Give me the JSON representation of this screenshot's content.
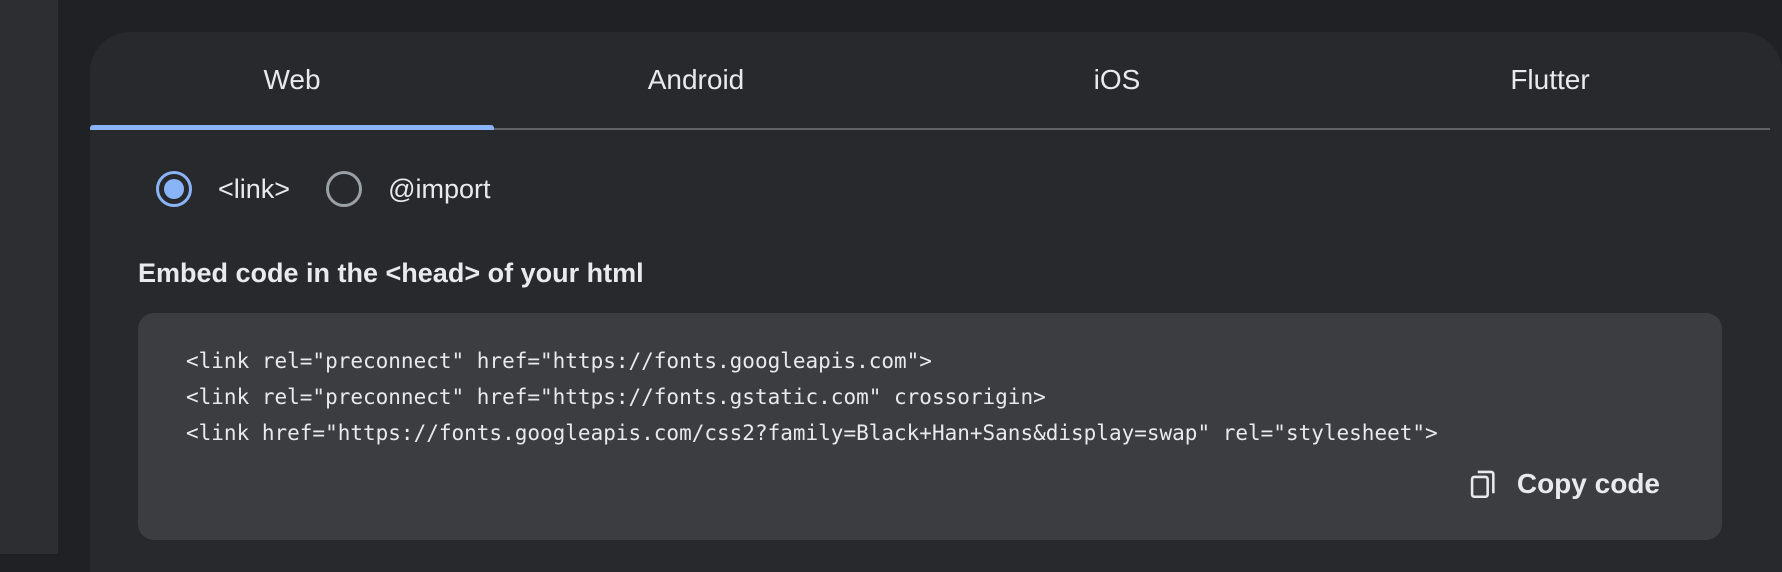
{
  "tabs": [
    {
      "label": "Web",
      "selected": true
    },
    {
      "label": "Android",
      "selected": false
    },
    {
      "label": "iOS",
      "selected": false
    },
    {
      "label": "Flutter",
      "selected": false
    }
  ],
  "embed_options": [
    {
      "label": "<link>",
      "checked": true
    },
    {
      "label": "@import",
      "checked": false
    }
  ],
  "embed": {
    "title": "Embed code in the <head> of your html",
    "code_lines": [
      "<link rel=\"preconnect\" href=\"https://fonts.googleapis.com\">",
      "<link rel=\"preconnect\" href=\"https://fonts.gstatic.com\" crossorigin>",
      "<link href=\"https://fonts.googleapis.com/css2?family=Black+Han+Sans&display=swap\" rel=\"stylesheet\">"
    ],
    "copy_label": "Copy code",
    "copy_icon": "copy-icon"
  },
  "colors": {
    "accent": "#8ab4f8",
    "background": "#202124",
    "panel": "#28292c",
    "code_background": "#3c3d41"
  }
}
